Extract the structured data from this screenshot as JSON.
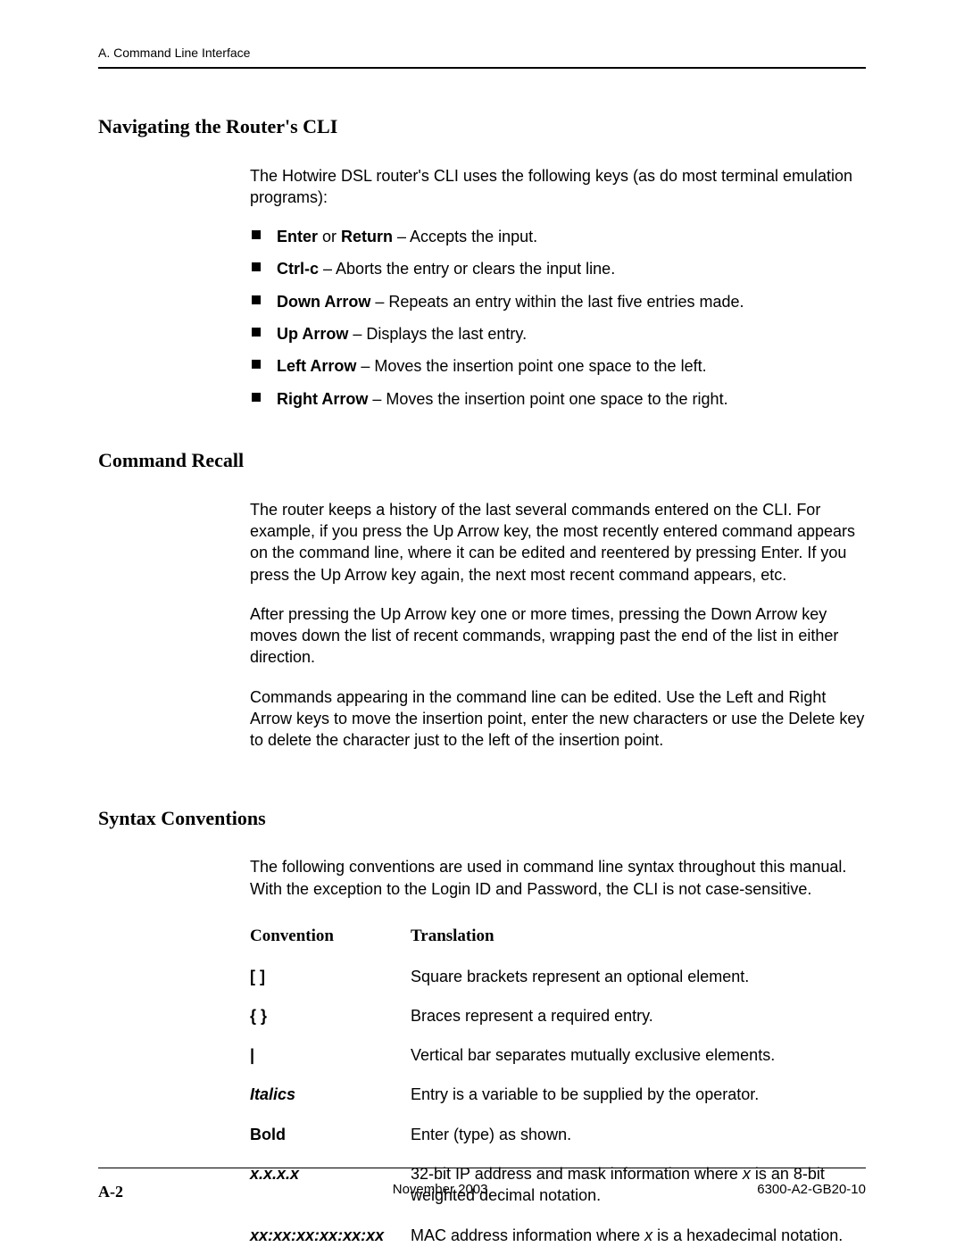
{
  "header": {
    "running_title": "A. Command Line Interface"
  },
  "section1": {
    "title": "Navigating the Router's CLI",
    "intro": "The Hotwire DSL router's CLI uses the following keys (as do most terminal emulation programs):",
    "items": [
      {
        "key_a": "Enter",
        "or": " or ",
        "key_b": "Return",
        "desc": " – Accepts the input."
      },
      {
        "key_a": "Ctrl-c",
        "desc": " – Aborts the entry or clears the input line."
      },
      {
        "key_a": "Down Arrow",
        "desc": " – Repeats an entry within the last five entries made."
      },
      {
        "key_a": "Up Arrow",
        "desc": " – Displays the last entry."
      },
      {
        "key_a": "Left Arrow",
        "desc": " – Moves the insertion point one space to the left."
      },
      {
        "key_a": "Right Arrow",
        "desc": " – Moves the insertion point one space to the right."
      }
    ]
  },
  "section2": {
    "title": "Command Recall",
    "p1": "The router keeps a history of the last several commands entered on the CLI. For example, if you press the Up Arrow key, the most recently entered command appears on the command line, where it can be edited and reentered by pressing Enter. If you press the Up Arrow key again, the next most recent command appears, etc.",
    "p2": "After pressing the Up Arrow key one or more times, pressing the Down Arrow key moves down the list of recent commands, wrapping past the end of the list in either direction.",
    "p3": "Commands appearing in the command line can be edited. Use the Left and Right Arrow keys to move the insertion point, enter the new characters or use the Delete key to delete the character just to the left of the insertion point."
  },
  "section3": {
    "title": "Syntax Conventions",
    "intro": "The following conventions are used in command line syntax throughout this manual. With the exception to the Login ID and Password, the CLI is not case-sensitive.",
    "table": {
      "head_convention": "Convention",
      "head_translation": "Translation",
      "rows": [
        {
          "conv": "[ ]",
          "class": "",
          "trans": "Square brackets represent an optional element."
        },
        {
          "conv": "{ }",
          "class": "",
          "trans": "Braces represent a required entry."
        },
        {
          "conv": "|",
          "class": "",
          "trans": "Vertical bar separates mutually exclusive elements."
        },
        {
          "conv": "Italics",
          "class": "conv-italic",
          "trans": "Entry is a variable to be supplied by the operator."
        },
        {
          "conv": "Bold",
          "class": "conv-mono",
          "trans": "Enter (type) as shown."
        },
        {
          "conv": "x.x.x.x",
          "class": "conv-ipx",
          "trans_pre": "32-bit IP address and mask information where ",
          "trans_var": "x",
          "trans_post": " is an 8-bit weighted decimal notation."
        },
        {
          "conv": "xx:xx:xx:xx:xx:xx",
          "class": "conv-mac",
          "trans_pre": "MAC address information where ",
          "trans_var": "x",
          "trans_post": " is a hexadecimal notation."
        }
      ]
    }
  },
  "footer": {
    "page": "A-2",
    "date": "November 2003",
    "docid": "6300-A2-GB20-10"
  }
}
